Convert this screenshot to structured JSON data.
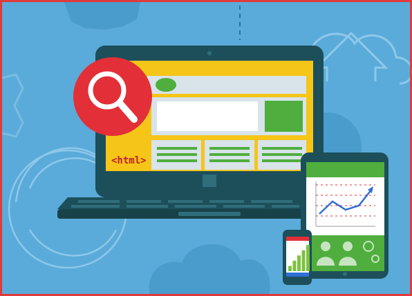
{
  "illustration": {
    "laptop_tag": "<html>",
    "colors": {
      "background": "#5aabd9",
      "background_shapes": "#4a9ccd",
      "device_body": "#1d4f5a",
      "screen_frame": "#f5c518",
      "content_panel": "#d8e3ea",
      "accent_green": "#4fae3d",
      "search_red": "#e32f38",
      "border_red": "#e23a3a"
    },
    "icons": [
      "magnifier-icon",
      "cloud-upload-icon",
      "cloud-icon",
      "gear-icon",
      "refresh-icon",
      "user-icon",
      "settings-icon"
    ],
    "tablet_chart": {
      "type": "line",
      "values": [
        3,
        6,
        4,
        5,
        9
      ]
    },
    "phone_chart": {
      "type": "bar",
      "values": [
        2,
        4,
        6,
        8,
        10
      ]
    }
  }
}
